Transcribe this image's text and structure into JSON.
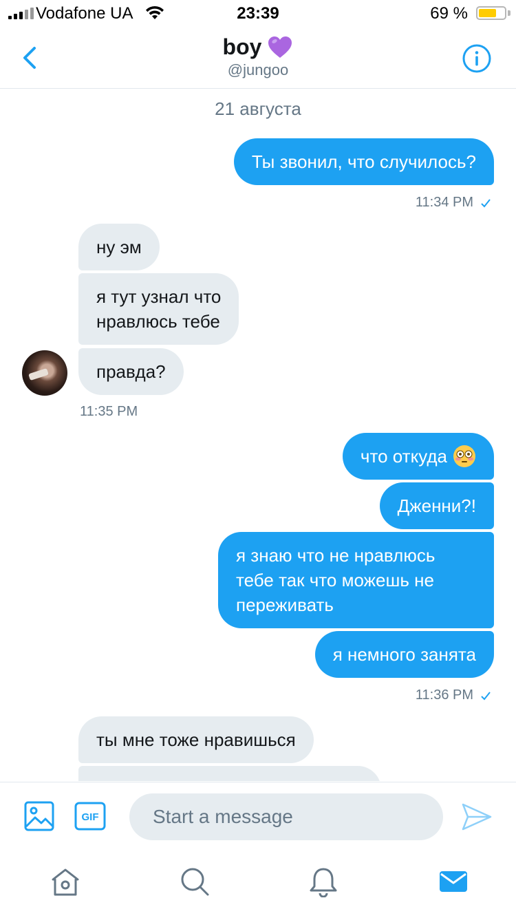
{
  "status_bar": {
    "carrier": "Vodafone UA",
    "time": "23:39",
    "battery_percent_label": "69 %",
    "battery_level": 0.69,
    "battery_color": "#ffcc00"
  },
  "header": {
    "title": "boy",
    "title_emoji_icon": "purple-heart-icon",
    "handle": "@jungoo",
    "back_icon": "chevron-left-icon",
    "info_icon": "info-icon",
    "accent_color": "#1da1f2"
  },
  "conversation": {
    "date_separator": "21 августа",
    "messages": [
      {
        "from": "me",
        "text": "Ты звонил, что случилось?"
      },
      {
        "from": "them",
        "text": "ну эм"
      },
      {
        "from": "them",
        "lines": [
          "я тут узнал что",
          "нравлюсь тебе"
        ]
      },
      {
        "from": "them",
        "text": "правда?"
      },
      {
        "from": "me",
        "text": "что откуда",
        "emoji_icon": "flushed-face-emoji-icon"
      },
      {
        "from": "me",
        "text": "Дженни?!"
      },
      {
        "from": "me",
        "lines": [
          "я знаю что не нравлюсь",
          "тебе так что можешь не",
          "переживать"
        ]
      },
      {
        "from": "me",
        "text": "я немного занята"
      },
      {
        "from": "them",
        "text": "ты мне тоже нравишься"
      }
    ],
    "timestamps": [
      "11:34 PM",
      "11:35 PM",
      "11:36 PM"
    ]
  },
  "compose": {
    "placeholder": "Start a message",
    "value": ""
  },
  "tabs": [
    {
      "icon": "home-icon",
      "active": false
    },
    {
      "icon": "search-icon",
      "active": false
    },
    {
      "icon": "notifications-bell-icon",
      "active": false
    },
    {
      "icon": "messages-envelope-icon",
      "active": true
    }
  ]
}
